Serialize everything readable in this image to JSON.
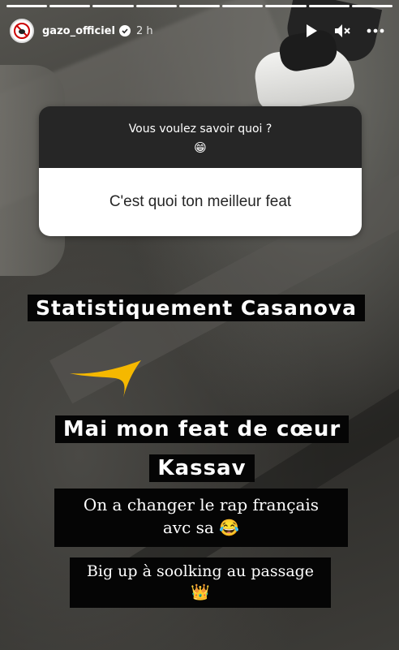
{
  "story": {
    "username": "gazo_officiel",
    "time": "2 h",
    "segments_total": 9,
    "segments_done": 9
  },
  "header_icons": [
    "verified-badge-icon",
    "play-icon",
    "mute-icon",
    "more-icon"
  ],
  "question": {
    "title": "Vous voulez savoir quoi ?",
    "emoji": "😁",
    "answer": "C'est quoi ton meilleur feat"
  },
  "captions": {
    "line1": "Statistiquement Casanova",
    "line2a": "Mai mon feat de cœur",
    "line2b": "Kassav",
    "line3a": "On a changer le rap français",
    "line3b": "avc sa 😂",
    "line4a": "Big up à soolking au passage",
    "line4b": "👑"
  },
  "colors": {
    "check_stroke": "#f5b800",
    "caption_bg": "#050505"
  }
}
